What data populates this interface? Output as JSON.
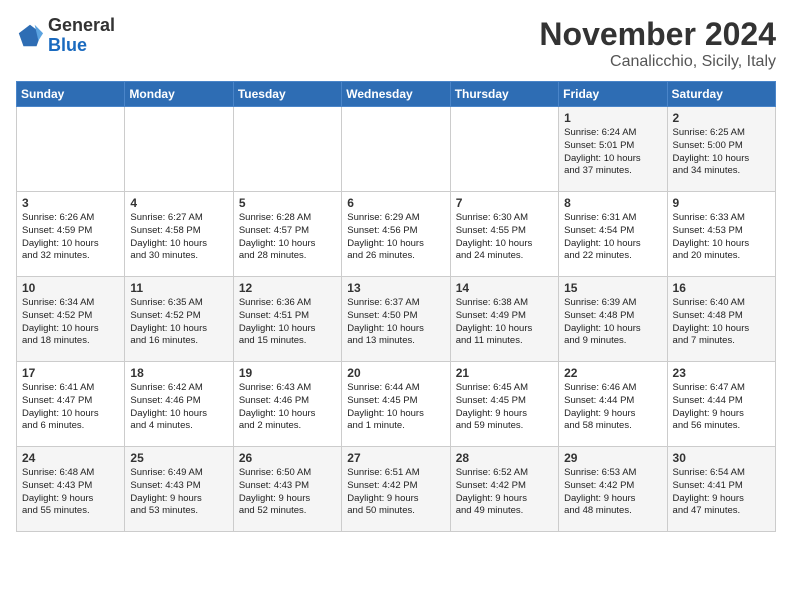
{
  "header": {
    "logo_line1": "General",
    "logo_line2": "Blue",
    "month_title": "November 2024",
    "location": "Canalicchio, Sicily, Italy"
  },
  "days_of_week": [
    "Sunday",
    "Monday",
    "Tuesday",
    "Wednesday",
    "Thursday",
    "Friday",
    "Saturday"
  ],
  "weeks": [
    [
      {
        "day": "",
        "info": ""
      },
      {
        "day": "",
        "info": ""
      },
      {
        "day": "",
        "info": ""
      },
      {
        "day": "",
        "info": ""
      },
      {
        "day": "",
        "info": ""
      },
      {
        "day": "1",
        "info": "Sunrise: 6:24 AM\nSunset: 5:01 PM\nDaylight: 10 hours\nand 37 minutes."
      },
      {
        "day": "2",
        "info": "Sunrise: 6:25 AM\nSunset: 5:00 PM\nDaylight: 10 hours\nand 34 minutes."
      }
    ],
    [
      {
        "day": "3",
        "info": "Sunrise: 6:26 AM\nSunset: 4:59 PM\nDaylight: 10 hours\nand 32 minutes."
      },
      {
        "day": "4",
        "info": "Sunrise: 6:27 AM\nSunset: 4:58 PM\nDaylight: 10 hours\nand 30 minutes."
      },
      {
        "day": "5",
        "info": "Sunrise: 6:28 AM\nSunset: 4:57 PM\nDaylight: 10 hours\nand 28 minutes."
      },
      {
        "day": "6",
        "info": "Sunrise: 6:29 AM\nSunset: 4:56 PM\nDaylight: 10 hours\nand 26 minutes."
      },
      {
        "day": "7",
        "info": "Sunrise: 6:30 AM\nSunset: 4:55 PM\nDaylight: 10 hours\nand 24 minutes."
      },
      {
        "day": "8",
        "info": "Sunrise: 6:31 AM\nSunset: 4:54 PM\nDaylight: 10 hours\nand 22 minutes."
      },
      {
        "day": "9",
        "info": "Sunrise: 6:33 AM\nSunset: 4:53 PM\nDaylight: 10 hours\nand 20 minutes."
      }
    ],
    [
      {
        "day": "10",
        "info": "Sunrise: 6:34 AM\nSunset: 4:52 PM\nDaylight: 10 hours\nand 18 minutes."
      },
      {
        "day": "11",
        "info": "Sunrise: 6:35 AM\nSunset: 4:52 PM\nDaylight: 10 hours\nand 16 minutes."
      },
      {
        "day": "12",
        "info": "Sunrise: 6:36 AM\nSunset: 4:51 PM\nDaylight: 10 hours\nand 15 minutes."
      },
      {
        "day": "13",
        "info": "Sunrise: 6:37 AM\nSunset: 4:50 PM\nDaylight: 10 hours\nand 13 minutes."
      },
      {
        "day": "14",
        "info": "Sunrise: 6:38 AM\nSunset: 4:49 PM\nDaylight: 10 hours\nand 11 minutes."
      },
      {
        "day": "15",
        "info": "Sunrise: 6:39 AM\nSunset: 4:48 PM\nDaylight: 10 hours\nand 9 minutes."
      },
      {
        "day": "16",
        "info": "Sunrise: 6:40 AM\nSunset: 4:48 PM\nDaylight: 10 hours\nand 7 minutes."
      }
    ],
    [
      {
        "day": "17",
        "info": "Sunrise: 6:41 AM\nSunset: 4:47 PM\nDaylight: 10 hours\nand 6 minutes."
      },
      {
        "day": "18",
        "info": "Sunrise: 6:42 AM\nSunset: 4:46 PM\nDaylight: 10 hours\nand 4 minutes."
      },
      {
        "day": "19",
        "info": "Sunrise: 6:43 AM\nSunset: 4:46 PM\nDaylight: 10 hours\nand 2 minutes."
      },
      {
        "day": "20",
        "info": "Sunrise: 6:44 AM\nSunset: 4:45 PM\nDaylight: 10 hours\nand 1 minute."
      },
      {
        "day": "21",
        "info": "Sunrise: 6:45 AM\nSunset: 4:45 PM\nDaylight: 9 hours\nand 59 minutes."
      },
      {
        "day": "22",
        "info": "Sunrise: 6:46 AM\nSunset: 4:44 PM\nDaylight: 9 hours\nand 58 minutes."
      },
      {
        "day": "23",
        "info": "Sunrise: 6:47 AM\nSunset: 4:44 PM\nDaylight: 9 hours\nand 56 minutes."
      }
    ],
    [
      {
        "day": "24",
        "info": "Sunrise: 6:48 AM\nSunset: 4:43 PM\nDaylight: 9 hours\nand 55 minutes."
      },
      {
        "day": "25",
        "info": "Sunrise: 6:49 AM\nSunset: 4:43 PM\nDaylight: 9 hours\nand 53 minutes."
      },
      {
        "day": "26",
        "info": "Sunrise: 6:50 AM\nSunset: 4:43 PM\nDaylight: 9 hours\nand 52 minutes."
      },
      {
        "day": "27",
        "info": "Sunrise: 6:51 AM\nSunset: 4:42 PM\nDaylight: 9 hours\nand 50 minutes."
      },
      {
        "day": "28",
        "info": "Sunrise: 6:52 AM\nSunset: 4:42 PM\nDaylight: 9 hours\nand 49 minutes."
      },
      {
        "day": "29",
        "info": "Sunrise: 6:53 AM\nSunset: 4:42 PM\nDaylight: 9 hours\nand 48 minutes."
      },
      {
        "day": "30",
        "info": "Sunrise: 6:54 AM\nSunset: 4:41 PM\nDaylight: 9 hours\nand 47 minutes."
      }
    ]
  ]
}
